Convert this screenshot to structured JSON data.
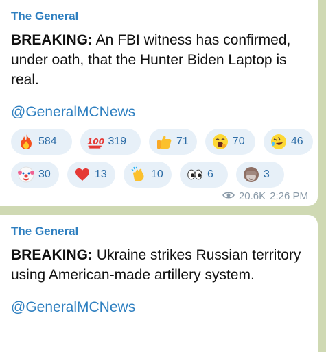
{
  "messages": [
    {
      "sender": "The General",
      "bold": "BREAKING:",
      "body": " An FBI witness has confirmed, under oath, that the Hunter Biden Laptop is real.",
      "handle": "@GeneralMCNews",
      "reactions_row1": [
        {
          "icon": "fire-icon",
          "count": "584"
        },
        {
          "icon": "hundred-points-icon",
          "count": "319"
        },
        {
          "icon": "thumbs-up-icon",
          "count": "71"
        },
        {
          "icon": "yawning-face-icon",
          "count": "70"
        },
        {
          "icon": "rolling-laughing-icon",
          "count": "46"
        }
      ],
      "reactions_row2": [
        {
          "icon": "clown-face-icon",
          "count": "30"
        },
        {
          "icon": "red-heart-icon",
          "count": "13"
        },
        {
          "icon": "clapping-hands-icon",
          "count": "10"
        },
        {
          "icon": "eyes-icon",
          "count": "6"
        },
        {
          "icon": "see-no-evil-monkey-icon",
          "count": "3"
        }
      ],
      "views": "20.6K",
      "time": "2:26 PM"
    },
    {
      "sender": "The General",
      "bold": "BREAKING:",
      "body": " Ukraine strikes Russian territory using American-made artillery system.",
      "handle": "@GeneralMCNews"
    }
  ],
  "colors": {
    "background": "#cfd9b3",
    "accent": "#2e7fc0",
    "pill": "#e7f0f8"
  }
}
